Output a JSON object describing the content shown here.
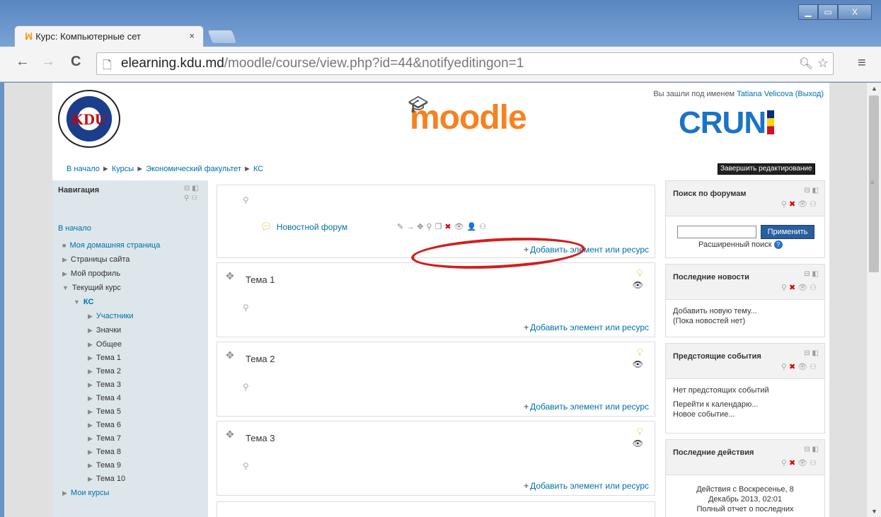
{
  "browser": {
    "tab_title": "Курс: Компьютерные сет",
    "tab_close": "×",
    "url_domain": "elearning.kdu.md",
    "url_path": "/moodle/course/view.php?id=44&notifyeditingon=1"
  },
  "header": {
    "login_prefix": "Вы зашли под именем",
    "user_name": "Tatiana Velicova",
    "logout": "(Выход)",
    "moodle_logo": "moodle",
    "crun_logo": "CRUN",
    "kdu_logo": "KDU"
  },
  "breadcrumb": {
    "items": [
      "В начало",
      "Курсы",
      "Экономический факультет",
      "КС"
    ],
    "sep": "►"
  },
  "edit_button": "Завершить редактирование",
  "navigation": {
    "title": "Навигация",
    "home": "В начало",
    "items": [
      {
        "label": "Моя домашняя страница"
      },
      {
        "label": "Страницы сайта"
      },
      {
        "label": "Мой профиль"
      },
      {
        "label": "Текущий курс"
      },
      {
        "label": "КС"
      },
      {
        "label": "Участники"
      },
      {
        "label": "Значки"
      },
      {
        "label": "Общее"
      },
      {
        "label": "Тема 1"
      },
      {
        "label": "Тема 2"
      },
      {
        "label": "Тема 3"
      },
      {
        "label": "Тема 4"
      },
      {
        "label": "Тема 5"
      },
      {
        "label": "Тема 6"
      },
      {
        "label": "Тема 7"
      },
      {
        "label": "Тема 8"
      },
      {
        "label": "Тема 9"
      },
      {
        "label": "Тема 10"
      },
      {
        "label": "Мои курсы"
      }
    ]
  },
  "course": {
    "forum": "Новостной форум",
    "add_resource": "Добавить элемент или ресурс",
    "sections": [
      "Тема 1",
      "Тема 2",
      "Тема 3"
    ]
  },
  "blocks": {
    "forum_search": {
      "title": "Поиск по форумам",
      "button": "Применить",
      "advanced": "Расширенный поиск"
    },
    "news": {
      "title": "Последние новости",
      "add": "Добавить новую тему...",
      "none": "(Пока новостей нет)"
    },
    "events": {
      "title": "Предстоящие события",
      "none": "Нет предстоящих событий",
      "calendar": "Перейти к календарю...",
      "new": "Новое событие..."
    },
    "activity": {
      "title": "Последние действия",
      "since": "Действия с Воскресенье, 8",
      "date": "Декабрь 2013, 02:01",
      "report": "Полный отчет о последних"
    }
  },
  "colors": {
    "accent": "#0070a8",
    "moodle_orange": "#f58220",
    "oval": "#d21e1e"
  }
}
